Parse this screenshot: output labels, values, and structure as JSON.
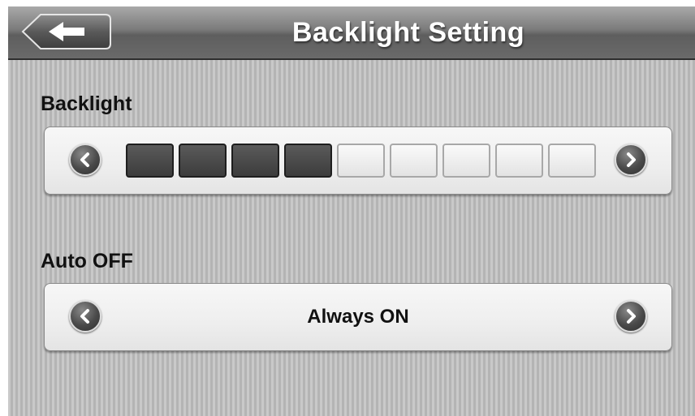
{
  "header": {
    "title": "Backlight Setting",
    "back_icon": "back-arrow-icon"
  },
  "backlight": {
    "label": "Backlight",
    "level": 4,
    "max_level": 9,
    "decrease_icon": "chevron-left-icon",
    "increase_icon": "chevron-right-icon"
  },
  "auto_off": {
    "label": "Auto OFF",
    "value": "Always ON",
    "prev_icon": "chevron-left-icon",
    "next_icon": "chevron-right-icon"
  },
  "colors": {
    "segment_on": "#3c3c3c",
    "segment_off": "#eeeeee",
    "title_text": "#ffffff"
  }
}
